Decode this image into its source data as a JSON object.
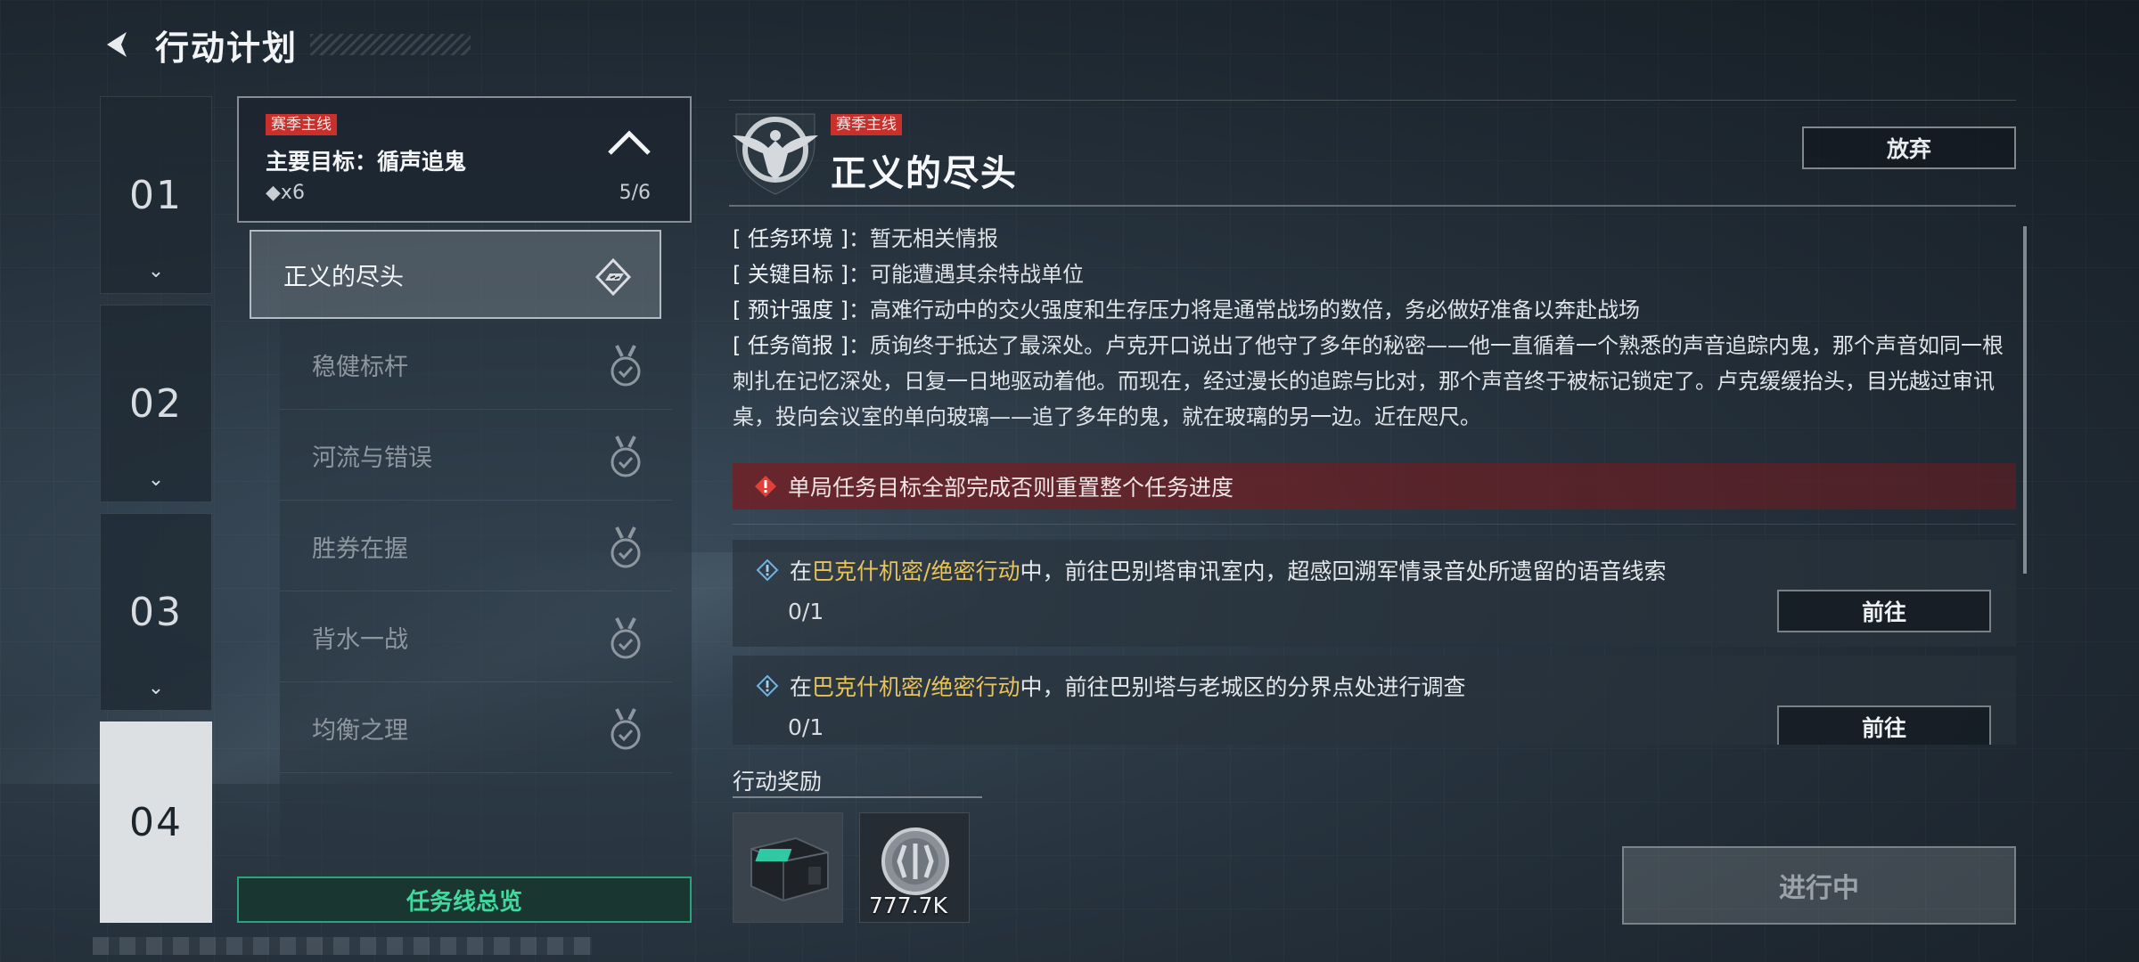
{
  "header": {
    "title": "行动计划"
  },
  "chapters": [
    {
      "num": "01",
      "active": false
    },
    {
      "num": "02",
      "active": false
    },
    {
      "num": "03",
      "active": false
    },
    {
      "num": "04",
      "active": true
    }
  ],
  "questline": {
    "tag": "赛季主线",
    "goal": "主要目标：循声追鬼",
    "diamond_count": "◆x6",
    "progress": "5/6",
    "items": [
      {
        "label": "正义的尽头",
        "state": "active"
      },
      {
        "label": "稳健标杆",
        "state": "completed"
      },
      {
        "label": "河流与错误",
        "state": "completed"
      },
      {
        "label": "胜券在握",
        "state": "completed"
      },
      {
        "label": "背水一战",
        "state": "completed"
      },
      {
        "label": "均衡之理",
        "state": "completed"
      }
    ],
    "overview_button": "任务线总览"
  },
  "detail": {
    "tag": "赛季主线",
    "title": "正义的尽头",
    "abandon_button": "放弃",
    "info": [
      {
        "key": "[ 任务环境 ]",
        "value": "暂无相关情报"
      },
      {
        "key": "[ 关键目标 ]",
        "value": "可能遭遇其余特战单位"
      },
      {
        "key": "[ 预计强度 ]",
        "value": "高难行动中的交火强度和生存压力将是通常战场的数倍，务必做好准备以奔赴战场"
      },
      {
        "key": "[ 任务简报 ]",
        "value": "质询终于抵达了最深处。卢克开口说出了他守了多年的秘密——他一直循着一个熟悉的声音追踪内鬼，那个声音如同一根刺扎在记忆深处，日复一日地驱动着他。而现在，经过漫长的追踪与比对，那个声音终于被标记锁定了。卢克缓缓抬头，目光越过审讯桌，投向会议室的单向玻璃——追了多年的鬼，就在玻璃的另一边。近在咫尺。"
      }
    ],
    "info_separator": "：",
    "warning": "单局任务目标全部完成否则重置整个任务进度",
    "tasks": [
      {
        "prefix": "在",
        "highlight": "巴克什机密/绝密行动",
        "suffix": "中，前往巴别塔审讯室内，超感回溯军情录音处所遗留的语音线索",
        "count": "0/1",
        "button": "前往"
      },
      {
        "prefix": "在",
        "highlight": "巴克什机密/绝密行动",
        "suffix": "中，前往巴别塔与老城区的分界点处进行调查",
        "count": "0/1",
        "button": "前往"
      }
    ],
    "reward_label": "行动奖励",
    "rewards": [
      {
        "icon": "equipment-case-icon",
        "qty": ""
      },
      {
        "icon": "coin-icon",
        "qty": "777.7K"
      }
    ],
    "status_button": "进行中"
  },
  "colors": {
    "tag_red": "#c8302c",
    "highlight_yellow": "#e8c35a",
    "overview_green": "#3fd99e",
    "warning_bg": "#781c20"
  }
}
